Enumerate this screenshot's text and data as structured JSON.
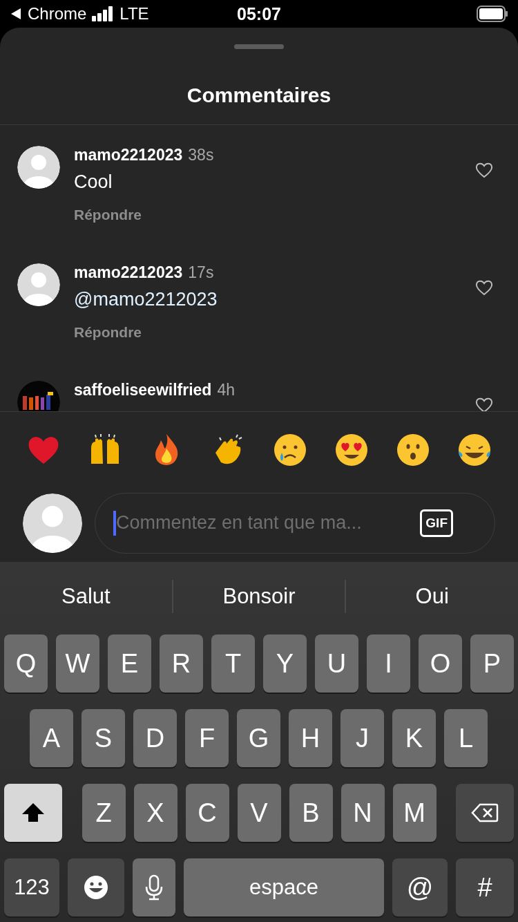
{
  "status_bar": {
    "back_app": "Chrome",
    "network": "LTE",
    "time": "05:07"
  },
  "sheet": {
    "title": "Commentaires"
  },
  "comments": [
    {
      "user": "mamo2212023",
      "time": "38s",
      "text": "Cool",
      "mention": false,
      "reply": "Répondre",
      "liked": false,
      "avatar": {
        "kind": "default"
      }
    },
    {
      "user": "mamo2212023",
      "time": "17s",
      "text": "@mamo2212023",
      "mention": true,
      "reply": "Répondre",
      "liked": false,
      "avatar": {
        "kind": "default"
      }
    },
    {
      "user": "saffoeliseewilfried",
      "time": "4h",
      "liked": false
    }
  ],
  "reactions": [
    {
      "kind": "heart"
    },
    {
      "kind": "raised-hands"
    },
    {
      "kind": "fire"
    },
    {
      "kind": "clap"
    },
    {
      "kind": "crying"
    },
    {
      "kind": "heart-eyes"
    },
    {
      "kind": "surprised"
    },
    {
      "kind": "laughing"
    }
  ],
  "composer": {
    "placeholder": "Commentez en tant que ma...",
    "gif": "GIF"
  },
  "keyboard": {
    "suggestions": [
      "Salut",
      "Bonsoir",
      "Oui"
    ],
    "rows": [
      {
        "keys": [
          {
            "label": "Q",
            "kind": "letter"
          },
          {
            "label": "W",
            "kind": "letter"
          },
          {
            "label": "E",
            "kind": "letter"
          },
          {
            "label": "R",
            "kind": "letter"
          },
          {
            "label": "T",
            "kind": "letter"
          },
          {
            "label": "Y",
            "kind": "letter"
          },
          {
            "label": "U",
            "kind": "letter"
          },
          {
            "label": "I",
            "kind": "letter"
          },
          {
            "label": "O",
            "kind": "letter"
          },
          {
            "label": "P",
            "kind": "letter"
          }
        ]
      },
      {
        "keys": [
          {
            "label": "A",
            "kind": "letter"
          },
          {
            "label": "S",
            "kind": "letter"
          },
          {
            "label": "D",
            "kind": "letter"
          },
          {
            "label": "F",
            "kind": "letter"
          },
          {
            "label": "G",
            "kind": "letter"
          },
          {
            "label": "H",
            "kind": "letter"
          },
          {
            "label": "J",
            "kind": "letter"
          },
          {
            "label": "K",
            "kind": "letter"
          },
          {
            "label": "L",
            "kind": "letter"
          }
        ]
      },
      {
        "keys": [
          {
            "kind": "shift",
            "on": true
          },
          {
            "label": "Z",
            "kind": "letter"
          },
          {
            "label": "X",
            "kind": "letter"
          },
          {
            "label": "C",
            "kind": "letter"
          },
          {
            "label": "V",
            "kind": "letter"
          },
          {
            "label": "B",
            "kind": "letter"
          },
          {
            "label": "N",
            "kind": "letter"
          },
          {
            "label": "M",
            "kind": "letter"
          },
          {
            "kind": "backspace"
          }
        ]
      },
      {
        "keys": [
          {
            "label": "123",
            "kind": "mode"
          },
          {
            "kind": "emoji"
          },
          {
            "kind": "mic"
          },
          {
            "label": "espace",
            "kind": "space"
          },
          {
            "label": "@",
            "kind": "symbol"
          },
          {
            "label": "#",
            "kind": "symbol"
          }
        ]
      }
    ]
  }
}
